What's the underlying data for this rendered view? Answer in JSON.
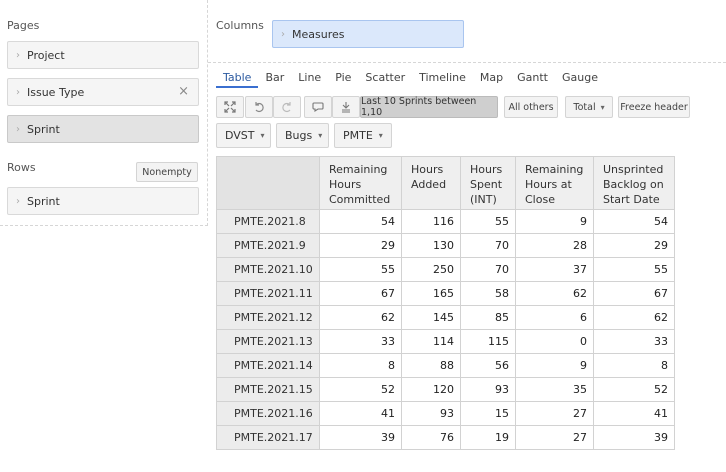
{
  "pages": {
    "title": "Pages",
    "items": [
      {
        "label": "Project"
      },
      {
        "label": "Issue Type",
        "close_icon": "close-icon"
      },
      {
        "label": "Sprint"
      }
    ]
  },
  "rows": {
    "title": "Rows",
    "nonempty_label": "Nonempty",
    "items": [
      {
        "label": "Sprint"
      }
    ]
  },
  "columns": {
    "title": "Columns",
    "items": [
      {
        "label": "Measures"
      }
    ]
  },
  "tabs": [
    "Table",
    "Bar",
    "Line",
    "Pie",
    "Scatter",
    "Timeline",
    "Map",
    "Gantt",
    "Gauge"
  ],
  "active_tab": "Table",
  "toolbar": {
    "icons": [
      "expand-icon",
      "undo-icon",
      "redo-icon",
      "comment-icon",
      "export-icon"
    ],
    "last_sprints": "Last 10 Sprints between 1,10",
    "all_others": "All others",
    "total": "Total",
    "freeze": "Freeze header"
  },
  "filters": [
    {
      "label": "DVST"
    },
    {
      "label": "Bugs"
    },
    {
      "label": "PMTE"
    }
  ],
  "table": {
    "headers": [
      [
        "Remaining",
        "Hours",
        "Committed"
      ],
      [
        "Hours",
        "Added"
      ],
      [
        "Hours",
        "Spent",
        "(INT)"
      ],
      [
        "Remaining",
        "Hours at",
        "Close"
      ],
      [
        "Unsprinted",
        "Backlog on",
        "Start Date"
      ]
    ],
    "rows": [
      {
        "label": "PMTE.2021.8",
        "values": [
          "54",
          "116",
          "55",
          "9",
          "54"
        ]
      },
      {
        "label": "PMTE.2021.9",
        "values": [
          "29",
          "130",
          "70",
          "28",
          "29"
        ]
      },
      {
        "label": "PMTE.2021.10",
        "values": [
          "55",
          "250",
          "70",
          "37",
          "55"
        ]
      },
      {
        "label": "PMTE.2021.11",
        "values": [
          "67",
          "165",
          "58",
          "62",
          "67"
        ]
      },
      {
        "label": "PMTE.2021.12",
        "values": [
          "62",
          "145",
          "85",
          "6",
          "62"
        ]
      },
      {
        "label": "PMTE.2021.13",
        "values": [
          "33",
          "114",
          "115",
          "0",
          "33"
        ]
      },
      {
        "label": "PMTE.2021.14",
        "values": [
          "8",
          "88",
          "56",
          "9",
          "8"
        ]
      },
      {
        "label": "PMTE.2021.15",
        "values": [
          "52",
          "120",
          "93",
          "35",
          "52"
        ]
      },
      {
        "label": "PMTE.2021.16",
        "values": [
          "41",
          "93",
          "15",
          "27",
          "41"
        ]
      },
      {
        "label": "PMTE.2021.17",
        "values": [
          "39",
          "76",
          "19",
          "27",
          "39"
        ]
      }
    ]
  }
}
